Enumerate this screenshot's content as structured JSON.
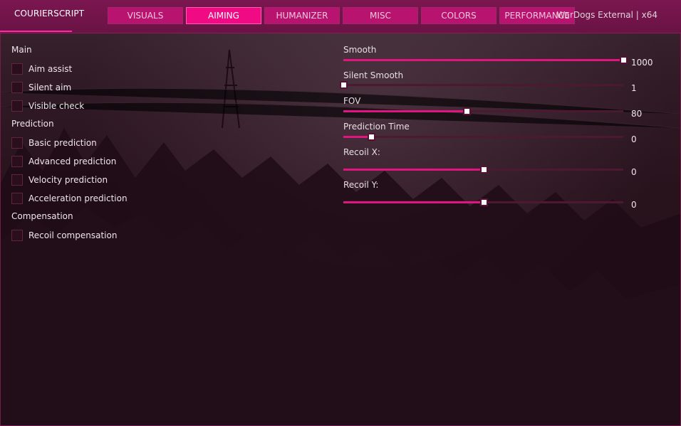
{
  "app": {
    "brand": "COURIERSCRIPT",
    "window_title": "WarDogs External | x64"
  },
  "tabs": [
    {
      "label": "VISUALS",
      "active": false
    },
    {
      "label": "AIMING",
      "active": true
    },
    {
      "label": "HUMANIZER",
      "active": false
    },
    {
      "label": "MISC",
      "active": false
    },
    {
      "label": "COLORS",
      "active": false
    },
    {
      "label": "PERFORMANCE",
      "active": false
    }
  ],
  "sections": {
    "main": {
      "title": "Main",
      "items": [
        {
          "label": "Aim assist",
          "checked": false
        },
        {
          "label": "Silent aim",
          "checked": false
        },
        {
          "label": "Visible check",
          "checked": false
        }
      ]
    },
    "prediction": {
      "title": "Prediction",
      "items": [
        {
          "label": "Basic prediction",
          "checked": false
        },
        {
          "label": "Advanced prediction",
          "checked": false
        },
        {
          "label": "Velocity prediction",
          "checked": false
        },
        {
          "label": "Acceleration prediction",
          "checked": false
        }
      ]
    },
    "compensation": {
      "title": "Compensation",
      "items": [
        {
          "label": "Recoil compensation",
          "checked": false
        }
      ]
    }
  },
  "sliders": [
    {
      "label": "Smooth",
      "value": "1000",
      "fraction": 1.0
    },
    {
      "label": "Silent Smooth",
      "value": "1",
      "fraction": 0.0
    },
    {
      "label": "FOV",
      "value": "80",
      "fraction": 0.44
    },
    {
      "label": "Prediction Time",
      "value": "0",
      "fraction": 0.1
    },
    {
      "label": "Recoil X:",
      "value": "0",
      "fraction": 0.5
    },
    {
      "label": "Recoil Y:",
      "value": "0",
      "fraction": 0.5
    }
  ],
  "colors": {
    "accent": "#e0157f",
    "tab": "#b8136e",
    "tab_active": "#f00a84",
    "titlebar": "#6a1345"
  }
}
